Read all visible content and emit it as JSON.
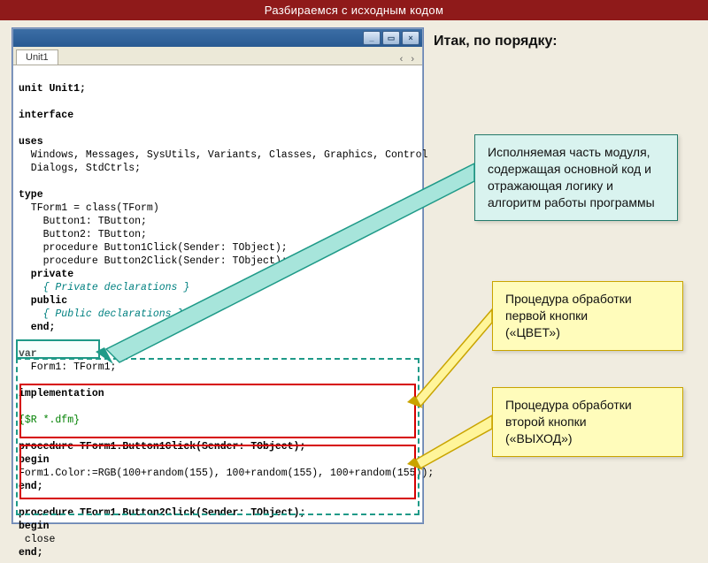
{
  "header": {
    "title": "Разбираемся с исходным кодом"
  },
  "subtitle": "Итак, по порядку:",
  "window": {
    "tab": "Unit1",
    "btn_min": "_",
    "btn_max": "▭",
    "btn_close": "×",
    "arrows": "‹ ›"
  },
  "code_lines": {
    "l1": "unit Unit1;",
    "l2": "",
    "l3": "interface",
    "l4": "",
    "l5": "uses",
    "l6": "  Windows, Messages, SysUtils, Variants, Classes, Graphics, Control",
    "l7": "  Dialogs, StdCtrls;",
    "l8": "",
    "l9": "type",
    "l10": "  TForm1 = class(TForm)",
    "l11": "    Button1: TButton;",
    "l12": "    Button2: TButton;",
    "l13": "    procedure Button1Click(Sender: TObject);",
    "l14": "    procedure Button2Click(Sender: TObject);",
    "l15": "  private",
    "l16": "    { Private declarations }",
    "l17": "  public",
    "l18": "    { Public declarations }",
    "l19": "  end;",
    "l20": "",
    "l21": "var",
    "l22": "  Form1: TForm1;",
    "l23": "",
    "l24": "implementation",
    "l25": "",
    "l26": "{$R *.dfm}",
    "l27": "",
    "l28": "procedure TForm1.Button1Click(Sender: TObject);",
    "l29": "begin",
    "l30": "Form1.Color:=RGB(100+random(155), 100+random(155), 100+random(155));",
    "l31": "end;",
    "l32": "",
    "l33": "procedure TForm1.Button2Click(Sender: TObject);",
    "l34": "begin",
    "l35": " close",
    "l36": "end;"
  },
  "callouts": {
    "teal": "Исполняемая часть модуля, содержащая основной код  и отражающая логику и алгоритм работы программы",
    "yellow1_a": "Процедура обработки первой кнопки",
    "yellow1_b": "        («ЦВЕТ»)",
    "yellow2_a": "Процедура обработки второй кнопки",
    "yellow2_b": "(«ВЫХОД»)"
  }
}
